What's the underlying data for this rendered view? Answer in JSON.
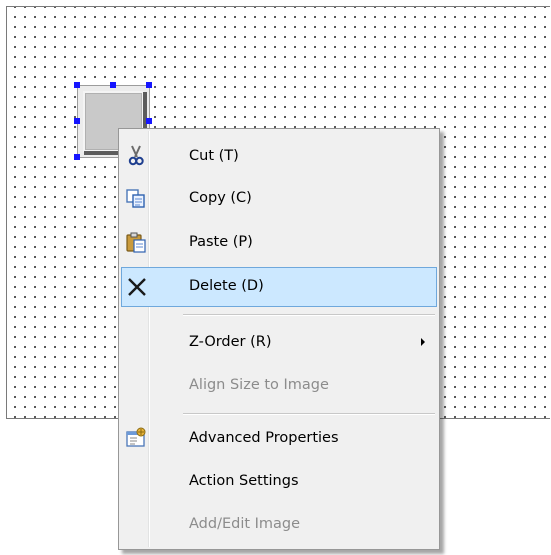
{
  "menu": {
    "items": [
      {
        "label": "Cut (T)",
        "icon": "scissors-icon",
        "enabled": true
      },
      {
        "label": "Copy (C)",
        "icon": "copy-icon",
        "enabled": true
      },
      {
        "label": "Paste (P)",
        "icon": "paste-icon",
        "enabled": true
      },
      {
        "label": "Delete (D)",
        "icon": "delete-x-icon",
        "enabled": true,
        "highlighted": true
      },
      {
        "label": "Z-Order (R)",
        "icon": null,
        "enabled": true,
        "submenu": true
      },
      {
        "label": "Align Size to Image",
        "icon": null,
        "enabled": false
      },
      {
        "label": "Advanced Properties",
        "icon": "properties-icon",
        "enabled": true
      },
      {
        "label": "Action Settings",
        "icon": null,
        "enabled": true
      },
      {
        "label": "Add/Edit Image",
        "icon": null,
        "enabled": false
      }
    ]
  },
  "colors": {
    "highlight_bg": "#cce8ff",
    "highlight_border": "#6fa8dc",
    "selection_handle": "#1515ff",
    "disabled_text": "#8c8c8c"
  }
}
